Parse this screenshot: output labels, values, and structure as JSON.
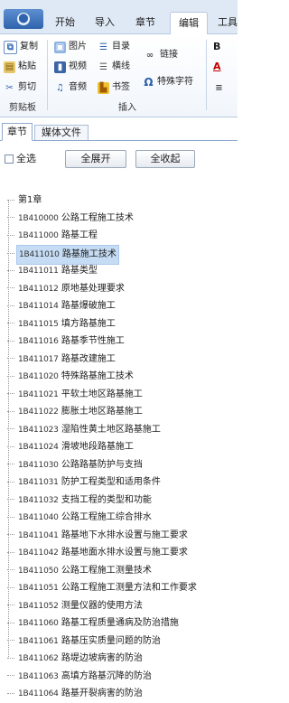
{
  "tabs": {
    "items": [
      "开始",
      "导入",
      "章节",
      "编辑",
      "工具"
    ],
    "active": "编辑"
  },
  "ribbon": {
    "clipboard": {
      "copy": "复制",
      "paste": "粘贴",
      "cut": "剪切",
      "group_label": "剪贴板"
    },
    "insert": {
      "image": "图片",
      "video": "视频",
      "audio": "音频",
      "toc": "目录",
      "hline": "横线",
      "bookmark": "书签",
      "link": "链接",
      "special_char": "特殊字符",
      "group_label": "插入"
    },
    "format": {
      "bold": "B",
      "color": "A"
    }
  },
  "panel_tabs": [
    "章节",
    "媒体文件"
  ],
  "controls": {
    "select_all": "全选",
    "expand_all": "全展开",
    "collapse_all": "全收起"
  },
  "tree": {
    "root": "第1章",
    "items": [
      {
        "code": "1B410000",
        "title": "公路工程施工技术"
      },
      {
        "code": "1B411000",
        "title": "路基工程"
      },
      {
        "code": "1B411010",
        "title": "路基施工技术"
      },
      {
        "code": "1B411011",
        "title": "路基类型"
      },
      {
        "code": "1B411012",
        "title": "原地基处理要求"
      },
      {
        "code": "1B411014",
        "title": "路基爆破施工"
      },
      {
        "code": "1B411015",
        "title": "填方路基施工"
      },
      {
        "code": "1B411016",
        "title": "路基季节性施工"
      },
      {
        "code": "1B411017",
        "title": "路基改建施工"
      },
      {
        "code": "1B411020",
        "title": "特殊路基施工技术"
      },
      {
        "code": "1B411021",
        "title": "平软土地区路基施工"
      },
      {
        "code": "1B411022",
        "title": "膨胀土地区路基施工"
      },
      {
        "code": "1B411023",
        "title": "湿陷性黄土地区路基施工"
      },
      {
        "code": "1B411024",
        "title": "滑坡地段路基施工"
      },
      {
        "code": "1B411030",
        "title": "公路路基防护与支挡"
      },
      {
        "code": "1B411031",
        "title": "防护工程类型和适用条件"
      },
      {
        "code": "1B411032",
        "title": "支挡工程的类型和功能"
      },
      {
        "code": "1B411040",
        "title": "公路工程施工综合排水"
      },
      {
        "code": "1B411041",
        "title": "路基地下水排水设置与施工要求"
      },
      {
        "code": "1B411042",
        "title": "路基地面水排水设置与施工要求"
      },
      {
        "code": "1B411050",
        "title": "公路工程施工测量技术"
      },
      {
        "code": "1B411051",
        "title": "公路工程施工测量方法和工作要求"
      },
      {
        "code": "1B411052",
        "title": "测量仪器的使用方法"
      },
      {
        "code": "1B411060",
        "title": "路基工程质量通病及防治措施"
      },
      {
        "code": "1B411061",
        "title": "路基压实质量问题的防治"
      },
      {
        "code": "1B411062",
        "title": "路堤边坡病害的防治"
      },
      {
        "code": "1B411063",
        "title": "高填方路基沉降的防治"
      },
      {
        "code": "1B411064",
        "title": "路基开裂病害的防治"
      }
    ],
    "selected_index": 2
  },
  "colors": {
    "tab_bar": "#dfe9f5",
    "selection": "#c6dcf4",
    "app_button": "#2f63ad"
  }
}
